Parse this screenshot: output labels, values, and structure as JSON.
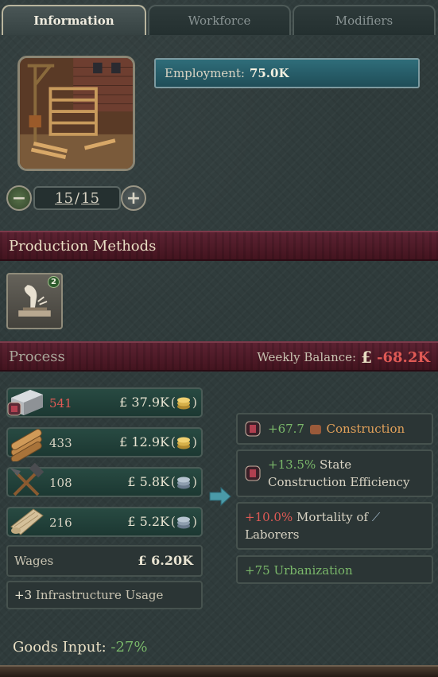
{
  "tabs": [
    {
      "label": "Information",
      "active": true
    },
    {
      "label": "Workforce",
      "active": false
    },
    {
      "label": "Modifiers",
      "active": false
    }
  ],
  "building": {
    "icon": "construction-sector-image",
    "level_current": "15",
    "level_max": "15",
    "decrease_icon": "minus-icon",
    "increase_icon": "plus-icon"
  },
  "employment": {
    "label": "Employment:",
    "value": "75.0K"
  },
  "production_methods": {
    "title": "Production Methods",
    "items": [
      {
        "icon": "construction-method-icon",
        "badge": "2"
      }
    ]
  },
  "process": {
    "title": "Process",
    "balance_label": "Weekly Balance:",
    "balance_currency": "£",
    "balance_value": "-68.2K"
  },
  "inputs": [
    {
      "good": "iron",
      "icon": "iron-ingot-icon",
      "qty": "541",
      "qty_color": "#e05a55",
      "price": "£ 37.9K",
      "coin": "gold-coins-icon"
    },
    {
      "good": "wood",
      "icon": "wood-logs-icon",
      "qty": "433",
      "qty_color": "#d9d4c4",
      "price": "£ 12.9K",
      "coin": "gold-coins-icon"
    },
    {
      "good": "tools",
      "icon": "tools-icon",
      "qty": "108",
      "qty_color": "#d9d4c4",
      "price": "£ 5.8K",
      "coin": "silver-coins-icon"
    },
    {
      "good": "fabric",
      "icon": "fabric-icon",
      "qty": "216",
      "qty_color": "#d9d4c4",
      "price": "£ 5.2K",
      "coin": "silver-coins-icon"
    }
  ],
  "wages": {
    "label": "Wages",
    "value": "£ 6.20K"
  },
  "infrastructure": {
    "value": "+3",
    "label": "Infrastructure Usage"
  },
  "outputs": [
    {
      "value": "+67.7",
      "label": "Construction",
      "icon": "construction-icon",
      "tone": "good"
    },
    {
      "value": "+13.5%",
      "label": "State Construction Efficiency",
      "tone": "good"
    },
    {
      "value": "+10.0%",
      "label": "Mortality of",
      "label2": "Laborers",
      "icon": "laborers-shovel-icon",
      "tone": "bad"
    },
    {
      "value": "+75",
      "label": "Urbanization",
      "tone": "good"
    }
  ],
  "goods_input": {
    "label": "Goods Input:",
    "value": "-27%"
  },
  "colors": {
    "positive": "#7ab86a",
    "negative": "#e05a55",
    "accent_teal": "#2f6d7a",
    "section_maroon": "#5c2232"
  }
}
